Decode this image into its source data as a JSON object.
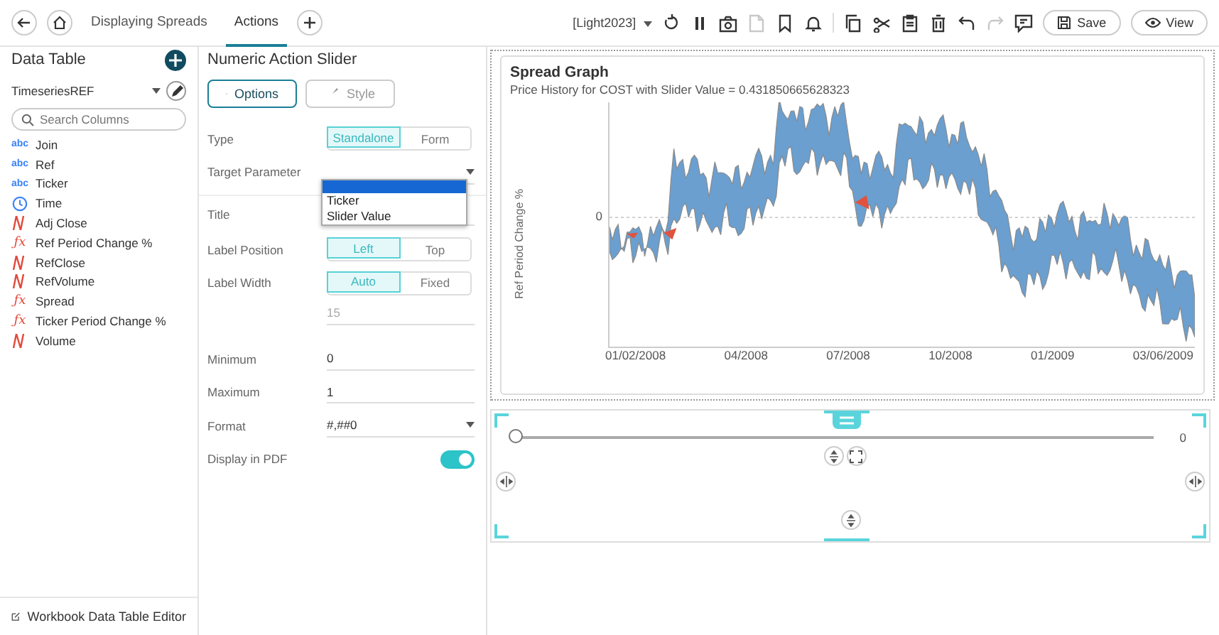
{
  "nav": {
    "tabs": [
      {
        "label": "Displaying Spreads",
        "selected": false
      },
      {
        "label": "Actions",
        "selected": true
      }
    ]
  },
  "toolbar": {
    "theme": "[Light2023]",
    "icons": [
      {
        "kind": "refresh",
        "disabled": false
      },
      {
        "kind": "pause",
        "disabled": false
      },
      {
        "kind": "snapshot",
        "disabled": false
      },
      {
        "kind": "pdf",
        "disabled": true
      },
      {
        "kind": "bookmark",
        "disabled": false
      },
      {
        "kind": "bell",
        "disabled": false
      },
      {
        "kind": "copy",
        "disabled": false
      },
      {
        "kind": "cut",
        "disabled": false
      },
      {
        "kind": "paste",
        "disabled": false
      },
      {
        "kind": "delete",
        "disabled": false
      },
      {
        "kind": "undo",
        "disabled": false
      },
      {
        "kind": "redo",
        "disabled": true
      },
      {
        "kind": "comment",
        "disabled": false
      }
    ],
    "save": "Save",
    "view": "View"
  },
  "data_table": {
    "title": "Data Table",
    "source": "TimeseriesREF",
    "search": {
      "placeholder": "Search Columns"
    },
    "columns": [
      {
        "name": "Join",
        "kind": "text",
        "icon_text": "abc"
      },
      {
        "name": "Ref",
        "kind": "text",
        "icon_text": "abc"
      },
      {
        "name": "Ticker",
        "kind": "text",
        "icon_text": "abc"
      },
      {
        "name": "Time",
        "kind": "time"
      },
      {
        "name": "Adj Close",
        "kind": "numeric"
      },
      {
        "name": "Ref Period Change %",
        "kind": "formula",
        "icon_text": "ƒx"
      },
      {
        "name": "RefClose",
        "kind": "numeric"
      },
      {
        "name": "RefVolume",
        "kind": "numeric"
      },
      {
        "name": "Spread",
        "kind": "formula",
        "icon_text": "ƒx"
      },
      {
        "name": "Ticker Period Change %",
        "kind": "formula",
        "icon_text": "ƒx"
      },
      {
        "name": "Volume",
        "kind": "numeric"
      }
    ],
    "footer": "Workbook Data Table Editor"
  },
  "settings": {
    "title": "Numeric Action Slider",
    "tabs": [
      {
        "label": "Options",
        "selected": true
      },
      {
        "label": "Style",
        "selected": false
      }
    ],
    "rows": [
      {
        "label": "Type",
        "kind": "segmented",
        "options": [
          {
            "label": "Standalone",
            "selected": true
          },
          {
            "label": "Form",
            "selected": false
          }
        ]
      },
      {
        "label": "Target Parameter",
        "kind": "dropdown",
        "open": true,
        "options": [
          "Ticker",
          "Slider Value"
        ]
      },
      {
        "label": "Title",
        "kind": "text"
      },
      {
        "label": "Label Position",
        "kind": "segmented",
        "options": [
          {
            "label": "Left",
            "selected": true
          },
          {
            "label": "Top",
            "selected": false
          }
        ]
      },
      {
        "label": "Label Width",
        "kind": "segmented",
        "options": [
          {
            "label": "Auto",
            "selected": true
          },
          {
            "label": "Fixed",
            "selected": false
          }
        ],
        "sub_value": "15"
      },
      {
        "label": "Minimum",
        "kind": "text",
        "value": "0"
      },
      {
        "label": "Maximum",
        "kind": "text",
        "value": "1"
      },
      {
        "label": "Format",
        "kind": "dropdown",
        "value": "#,##0"
      },
      {
        "label": "Display in PDF",
        "kind": "toggle",
        "on": true
      }
    ]
  },
  "chart": {
    "title": "Spread Graph",
    "subtitle": "Price History for COST with Slider Value = 0.431850665628323",
    "ylabel": "Ref Period Change %",
    "ytick": "0",
    "xticks": [
      "01/02/2008",
      "04/2008",
      "07/2008",
      "10/2008",
      "01/2009",
      "03/06/2009"
    ]
  },
  "slider": {
    "level": 0,
    "reading": "0"
  }
}
